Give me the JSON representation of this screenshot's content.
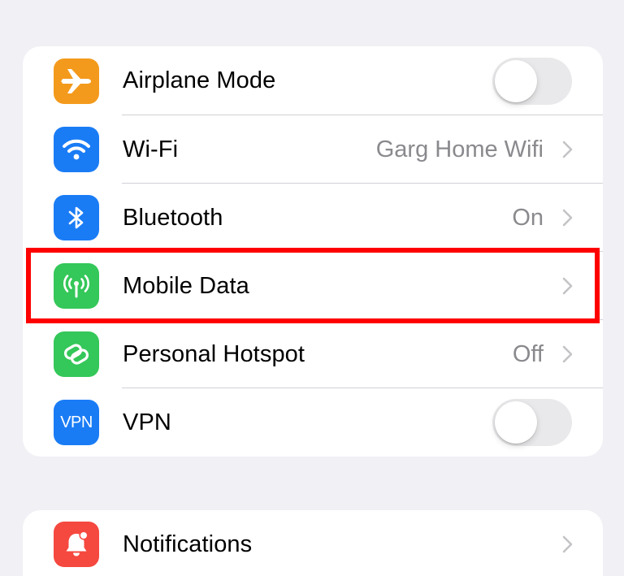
{
  "colors": {
    "orange": "#f39a1c",
    "blue": "#1a7cf5",
    "green": "#34c759",
    "red": "#f5483f",
    "highlight": "#ff0000"
  },
  "connectivity": {
    "rows": [
      {
        "label": "Airplane Mode",
        "icon": "airplane-icon",
        "control": "toggle",
        "toggle_on": false
      },
      {
        "label": "Wi-Fi",
        "icon": "wifi-icon",
        "detail": "Garg Home Wifi",
        "control": "chevron"
      },
      {
        "label": "Bluetooth",
        "icon": "bluetooth-icon",
        "detail": "On",
        "control": "chevron"
      },
      {
        "label": "Mobile Data",
        "icon": "antenna-icon",
        "detail": "",
        "control": "chevron",
        "highlighted": true
      },
      {
        "label": "Personal Hotspot",
        "icon": "hotspot-icon",
        "detail": "Off",
        "control": "chevron"
      },
      {
        "label": "VPN",
        "icon": "vpn-icon",
        "icon_text": "VPN",
        "control": "toggle",
        "toggle_on": false
      }
    ]
  },
  "general": {
    "rows": [
      {
        "label": "Notifications",
        "icon": "notifications-icon",
        "control": "chevron"
      }
    ]
  }
}
